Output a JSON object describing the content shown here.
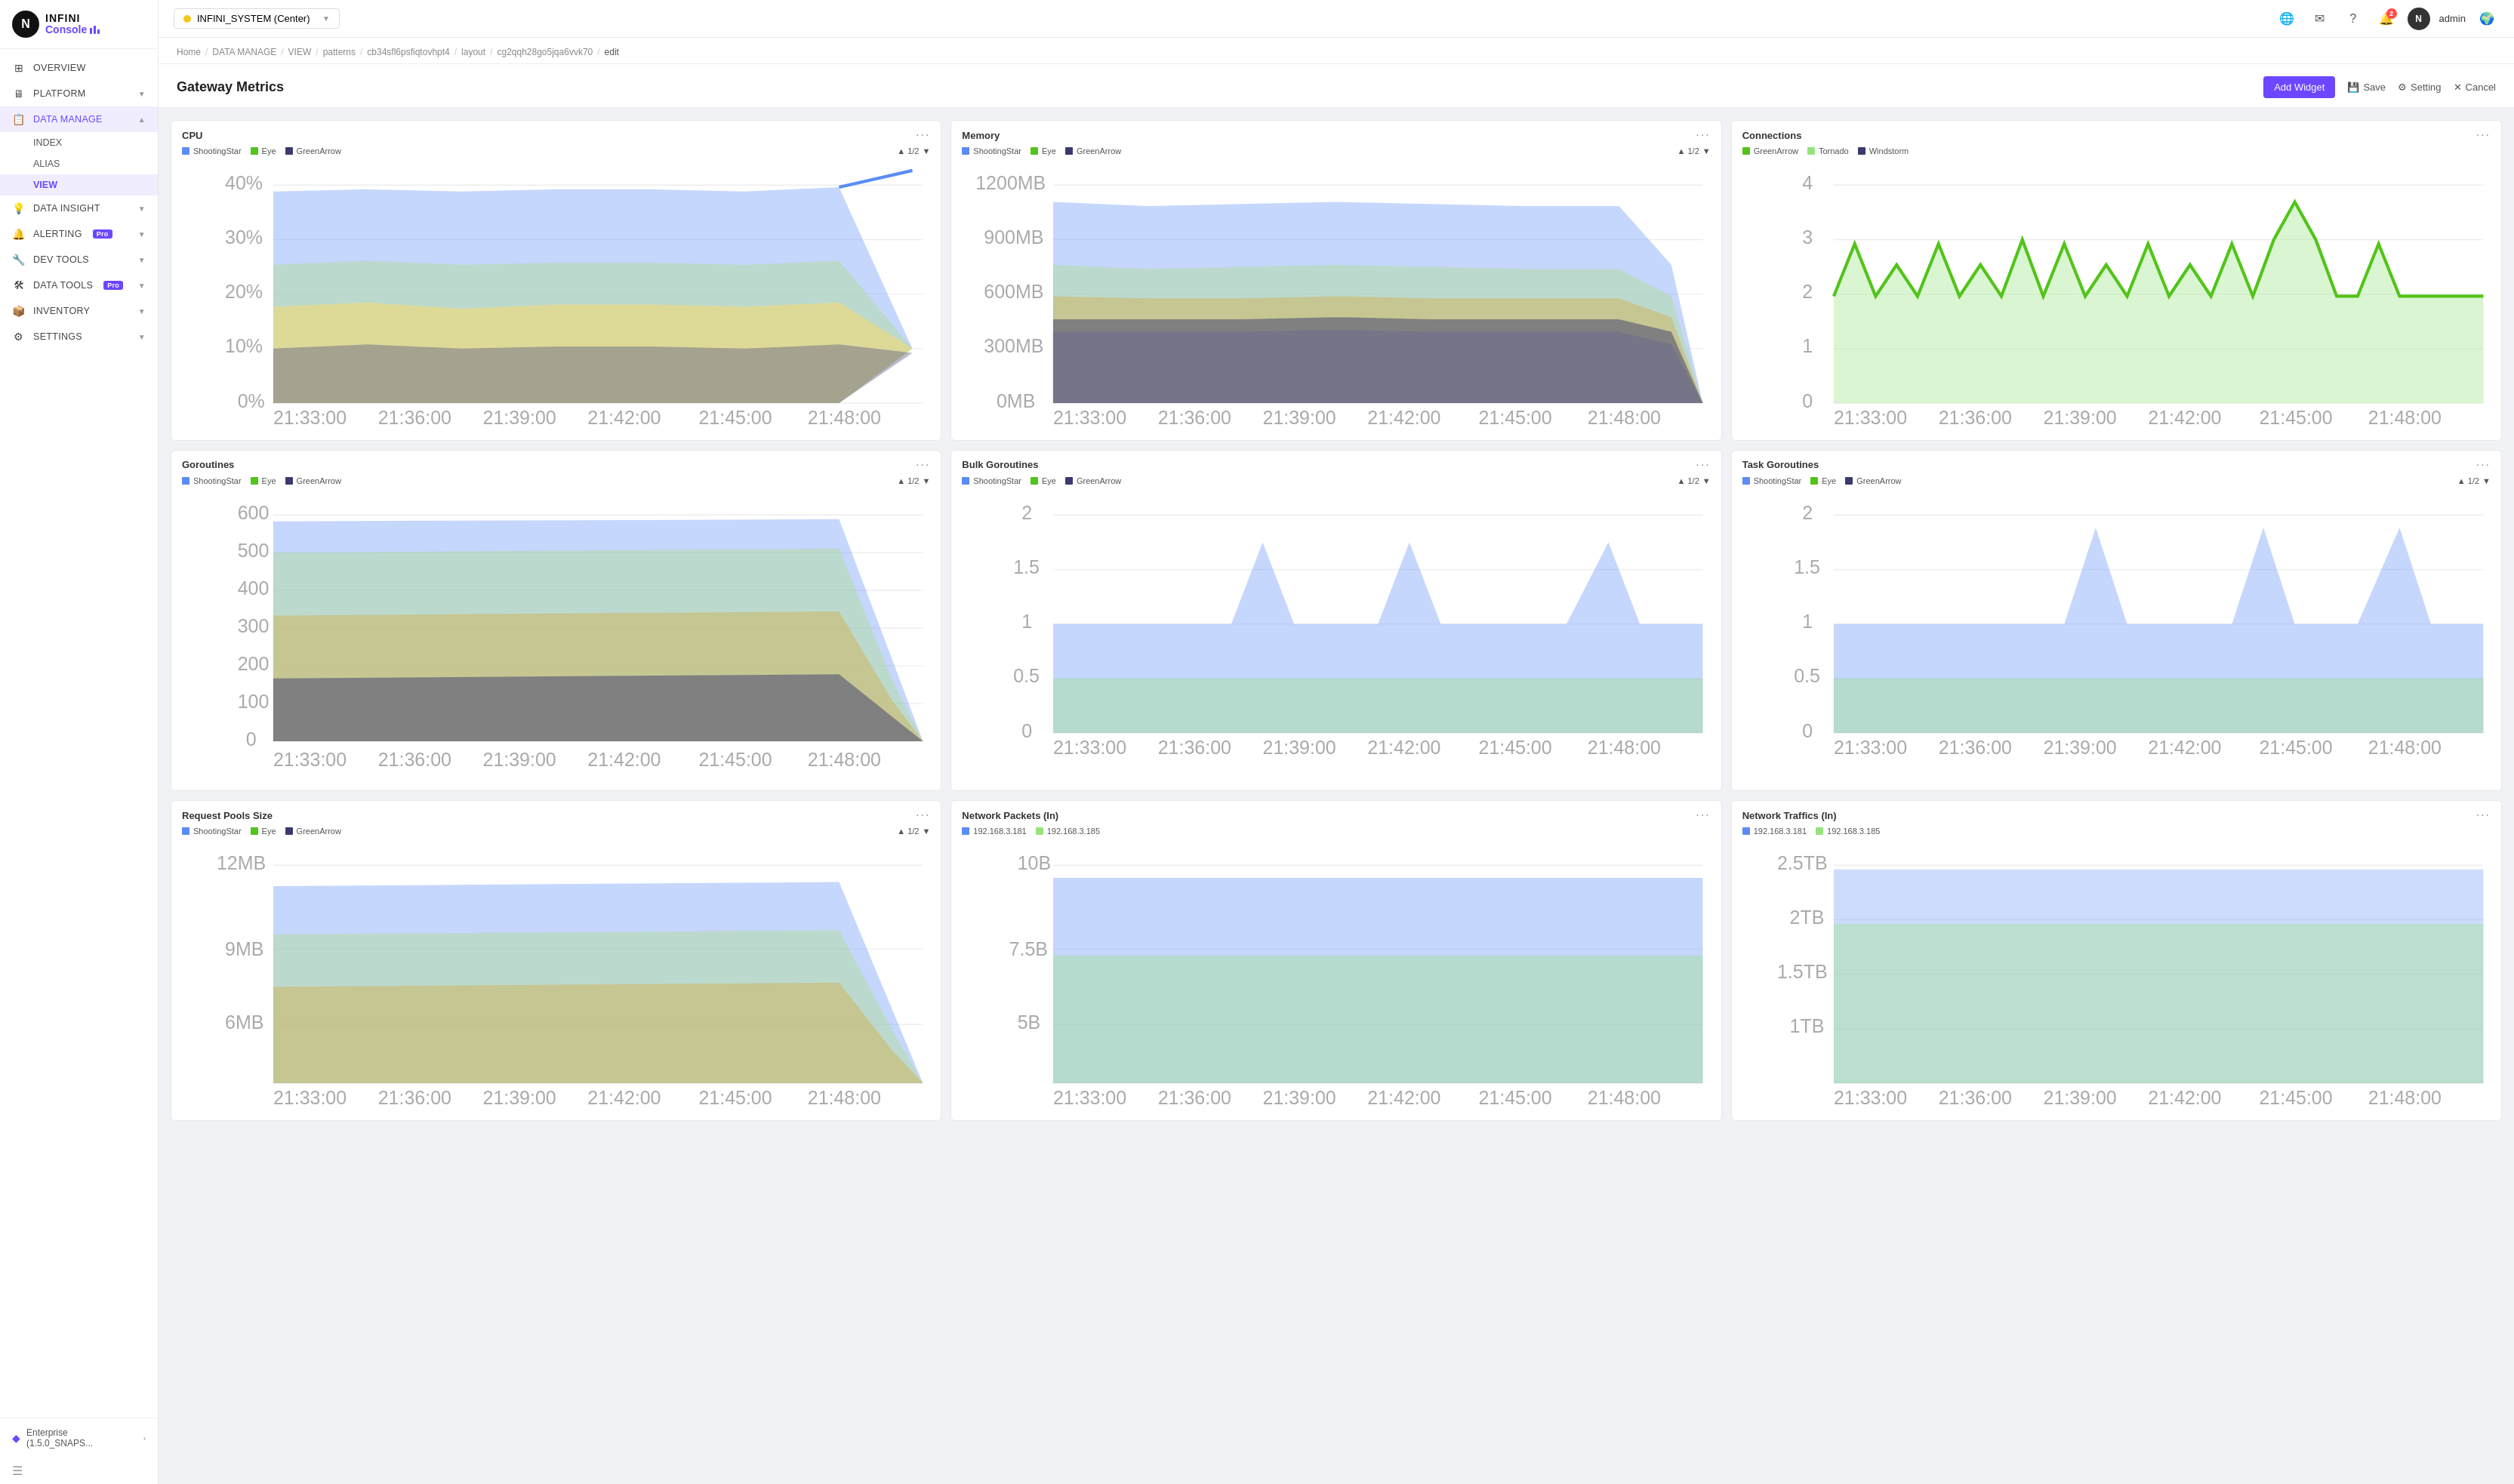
{
  "app": {
    "name": "INFINI Console",
    "logo_letter": "N"
  },
  "topbar": {
    "system_name": "INFINI_SYSTEM (Center)",
    "admin_label": "admin",
    "notif_count": "2"
  },
  "breadcrumb": {
    "items": [
      "Home",
      "DATA MANAGE",
      "VIEW",
      "patterns",
      "cb34sfl6psfiqtovhpt4",
      "layout",
      "cg2qqh28go5jqa6vvk70",
      "edit"
    ]
  },
  "page": {
    "title": "Gateway Metrics"
  },
  "toolbar": {
    "add_widget": "Add Widget",
    "save": "Save",
    "setting": "Setting",
    "cancel": "Cancel"
  },
  "sidebar": {
    "items": [
      {
        "label": "OVERVIEW",
        "icon": "⊞"
      },
      {
        "label": "PLATFORM",
        "icon": "🖥",
        "has_chevron": true
      },
      {
        "label": "DATA MANAGE",
        "icon": "📋",
        "active": true,
        "has_chevron": true
      },
      {
        "label": "INDEX",
        "sub": true
      },
      {
        "label": "ALIAS",
        "sub": true
      },
      {
        "label": "VIEW",
        "sub": true,
        "active_sub": true
      },
      {
        "label": "DATA INSIGHT",
        "icon": "💡",
        "has_chevron": true
      },
      {
        "label": "ALERTING",
        "icon": "🔔",
        "has_chevron": true,
        "pro": true
      },
      {
        "label": "DEV TOOLS",
        "icon": "🔧",
        "has_chevron": true
      },
      {
        "label": "DATA TOOLS",
        "icon": "🛠",
        "has_chevron": true,
        "pro": true
      },
      {
        "label": "INVENTORY",
        "icon": "📦",
        "has_chevron": true
      },
      {
        "label": "SETTINGS",
        "icon": "⚙",
        "has_chevron": true
      }
    ],
    "footer_label": "Enterprise (1.5.0_SNAPS...",
    "footer_arrow": "›"
  },
  "widgets": [
    {
      "id": "cpu",
      "title": "CPU",
      "legends": [
        {
          "label": "ShootingStar",
          "color": "#5b8cf5"
        },
        {
          "label": "Eye",
          "color": "#52c41a"
        },
        {
          "label": "GreenArrow",
          "color": "#3a3a6e"
        }
      ],
      "y_labels": [
        "40%",
        "30%",
        "20%",
        "10%",
        "0%"
      ],
      "x_labels": [
        "21:33:00",
        "21:36:00",
        "21:39:00",
        "21:42:00",
        "21:45:00",
        "21:48:00"
      ]
    },
    {
      "id": "memory",
      "title": "Memory",
      "legends": [
        {
          "label": "ShootingStar",
          "color": "#5b8cf5"
        },
        {
          "label": "Eye",
          "color": "#52c41a"
        },
        {
          "label": "GreenArrow",
          "color": "#3a3a6e"
        }
      ],
      "y_labels": [
        "1200MB",
        "900MB",
        "600MB",
        "300MB",
        "0MB"
      ],
      "x_labels": [
        "21:33:00",
        "21:36:00",
        "21:39:00",
        "21:42:00",
        "21:45:00",
        "21:48:00"
      ]
    },
    {
      "id": "connections",
      "title": "Connections",
      "legends": [
        {
          "label": "GreenArrow",
          "color": "#52c41a"
        },
        {
          "label": "Tornado",
          "color": "#96e37d"
        },
        {
          "label": "Windstorm",
          "color": "#3a3a6e"
        }
      ],
      "y_labels": [
        "4",
        "3",
        "2",
        "1",
        "0"
      ],
      "x_labels": [
        "21:33:00",
        "21:36:00",
        "21:39:00",
        "21:42:00",
        "21:45:00",
        "21:48:00"
      ]
    },
    {
      "id": "goroutines",
      "title": "Goroutines",
      "legends": [
        {
          "label": "ShootingStar",
          "color": "#5b8cf5"
        },
        {
          "label": "Eye",
          "color": "#52c41a"
        },
        {
          "label": "GreenArrow",
          "color": "#3a3a6e"
        }
      ],
      "y_labels": [
        "600",
        "500",
        "400",
        "300",
        "200",
        "100",
        "0"
      ],
      "x_labels": [
        "21:33:00",
        "21:36:00",
        "21:39:00",
        "21:42:00",
        "21:45:00",
        "21:48:00"
      ]
    },
    {
      "id": "bulk-goroutines",
      "title": "Bulk Goroutines",
      "legends": [
        {
          "label": "ShootingStar",
          "color": "#5b8cf5"
        },
        {
          "label": "Eye",
          "color": "#52c41a"
        },
        {
          "label": "GreenArrow",
          "color": "#3a3a6e"
        }
      ],
      "y_labels": [
        "2",
        "1.5",
        "1",
        "0.5",
        "0"
      ],
      "x_labels": [
        "21:33:00",
        "21:36:00",
        "21:39:00",
        "21:42:00",
        "21:45:00",
        "21:48:00"
      ]
    },
    {
      "id": "task-goroutines",
      "title": "Task Goroutines",
      "legends": [
        {
          "label": "ShootingStar",
          "color": "#5b8cf5"
        },
        {
          "label": "Eye",
          "color": "#52c41a"
        },
        {
          "label": "GreenArrow",
          "color": "#3a3a6e"
        }
      ],
      "y_labels": [
        "2",
        "1.5",
        "1",
        "0.5",
        "0"
      ],
      "x_labels": [
        "21:33:00",
        "21:36:00",
        "21:39:00",
        "21:42:00",
        "21:45:00",
        "21:48:00"
      ]
    },
    {
      "id": "request-pools",
      "title": "Request Pools Size",
      "legends": [
        {
          "label": "ShootingStar",
          "color": "#5b8cf5"
        },
        {
          "label": "Eye",
          "color": "#52c41a"
        },
        {
          "label": "GreenArrow",
          "color": "#3a3a6e"
        }
      ],
      "y_labels": [
        "12MB",
        "9MB",
        "6MB"
      ],
      "x_labels": [
        "21:33:00",
        "21:36:00",
        "21:39:00",
        "21:42:00",
        "21:45:00",
        "21:48:00"
      ]
    },
    {
      "id": "network-packets-in",
      "title": "Network Packets (In)",
      "legends": [
        {
          "label": "192.168.3.181",
          "color": "#5b8cf5"
        },
        {
          "label": "192.168.3.185",
          "color": "#96e37d"
        }
      ],
      "y_labels": [
        "10B",
        "7.5B",
        "5B"
      ],
      "x_labels": [
        "21:33:00",
        "21:36:00",
        "21:39:00",
        "21:42:00",
        "21:45:00",
        "21:48:00"
      ]
    },
    {
      "id": "network-traffics-in",
      "title": "Network Traffics (In)",
      "legends": [
        {
          "label": "192.168.3.181",
          "color": "#5b8cf5"
        },
        {
          "label": "192.168.3.185",
          "color": "#96e37d"
        }
      ],
      "y_labels": [
        "2.5TB",
        "2TB",
        "1.5TB",
        "1TB"
      ],
      "x_labels": [
        "21:33:00",
        "21:36:00",
        "21:39:00",
        "21:42:00",
        "21:45:00",
        "21:48:00"
      ]
    }
  ],
  "colors": {
    "accent": "#6c47ff",
    "blue": "#5b8cf5",
    "green": "#52c41a",
    "darkblue": "#3a3a6e",
    "lightgreen": "#96e37d",
    "yellow": "#f5c518"
  }
}
